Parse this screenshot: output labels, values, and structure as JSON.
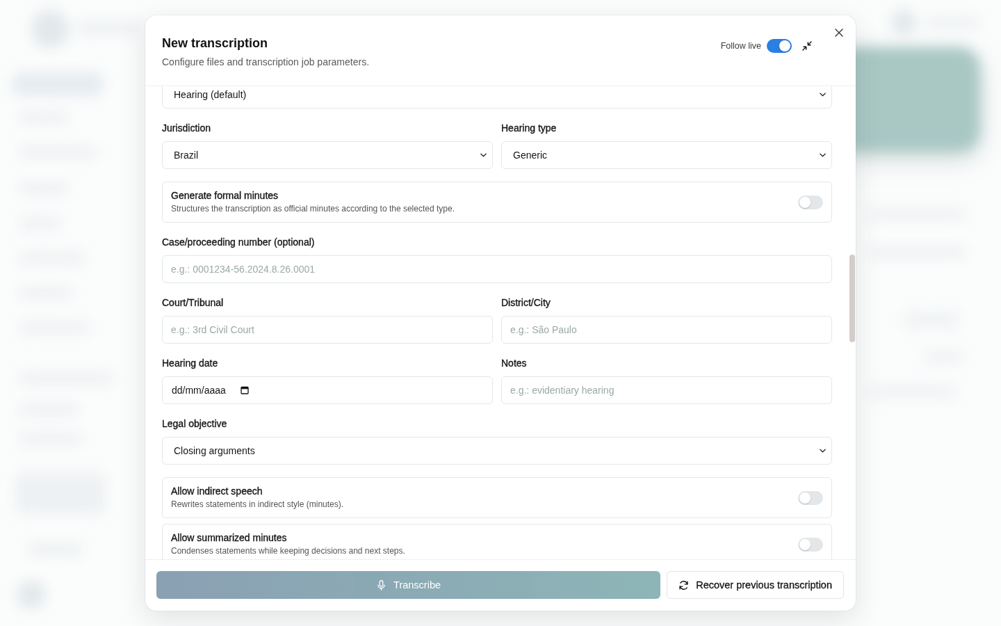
{
  "dialog": {
    "title": "New transcription",
    "subtitle": "Configure files and transcription job parameters.",
    "follow_live": {
      "label": "Follow live",
      "on": true
    }
  },
  "form": {
    "fields": [
      {
        "kind": "select",
        "value": "Hearing (default)"
      },
      {
        "kind": "row",
        "fields": [
          {
            "kind": "select",
            "label": "Jurisdiction",
            "value": "Brazil"
          },
          {
            "kind": "select",
            "label": "Hearing type",
            "value": "Generic"
          }
        ]
      },
      {
        "kind": "toggle",
        "title": "Generate formal minutes",
        "description": "Structures the transcription as official minutes according to the selected type.",
        "on": false
      },
      {
        "kind": "input",
        "label": "Case/proceeding number (optional)",
        "placeholder": "e.g.: 0001234-56.2024.8.26.0001"
      },
      {
        "kind": "row",
        "fields": [
          {
            "kind": "input",
            "label": "Court/Tribunal",
            "placeholder": "e.g.: 3rd Civil Court"
          },
          {
            "kind": "input",
            "label": "District/City",
            "placeholder": "e.g.: São Paulo"
          }
        ]
      },
      {
        "kind": "row",
        "fields": [
          {
            "kind": "date",
            "label": "Hearing date",
            "placeholder": "dd/mm/aaaa"
          },
          {
            "kind": "input",
            "label": "Notes",
            "placeholder": "e.g.: evidentiary hearing"
          }
        ]
      },
      {
        "kind": "select",
        "label": "Legal objective",
        "value": "Closing arguments"
      },
      {
        "kind": "toggle",
        "title": "Allow indirect speech",
        "description": "Rewrites statements in indirect style (minutes).",
        "on": false
      },
      {
        "kind": "toggle",
        "title": "Allow summarized minutes",
        "description": "Condenses statements while keeping decisions and next steps.",
        "on": false
      }
    ]
  },
  "footer": {
    "buttons": [
      {
        "kind": "primary",
        "label": "Transcribe",
        "disabled": true
      },
      {
        "kind": "secondary",
        "label": "Recover previous transcription",
        "disabled": false
      }
    ]
  }
}
